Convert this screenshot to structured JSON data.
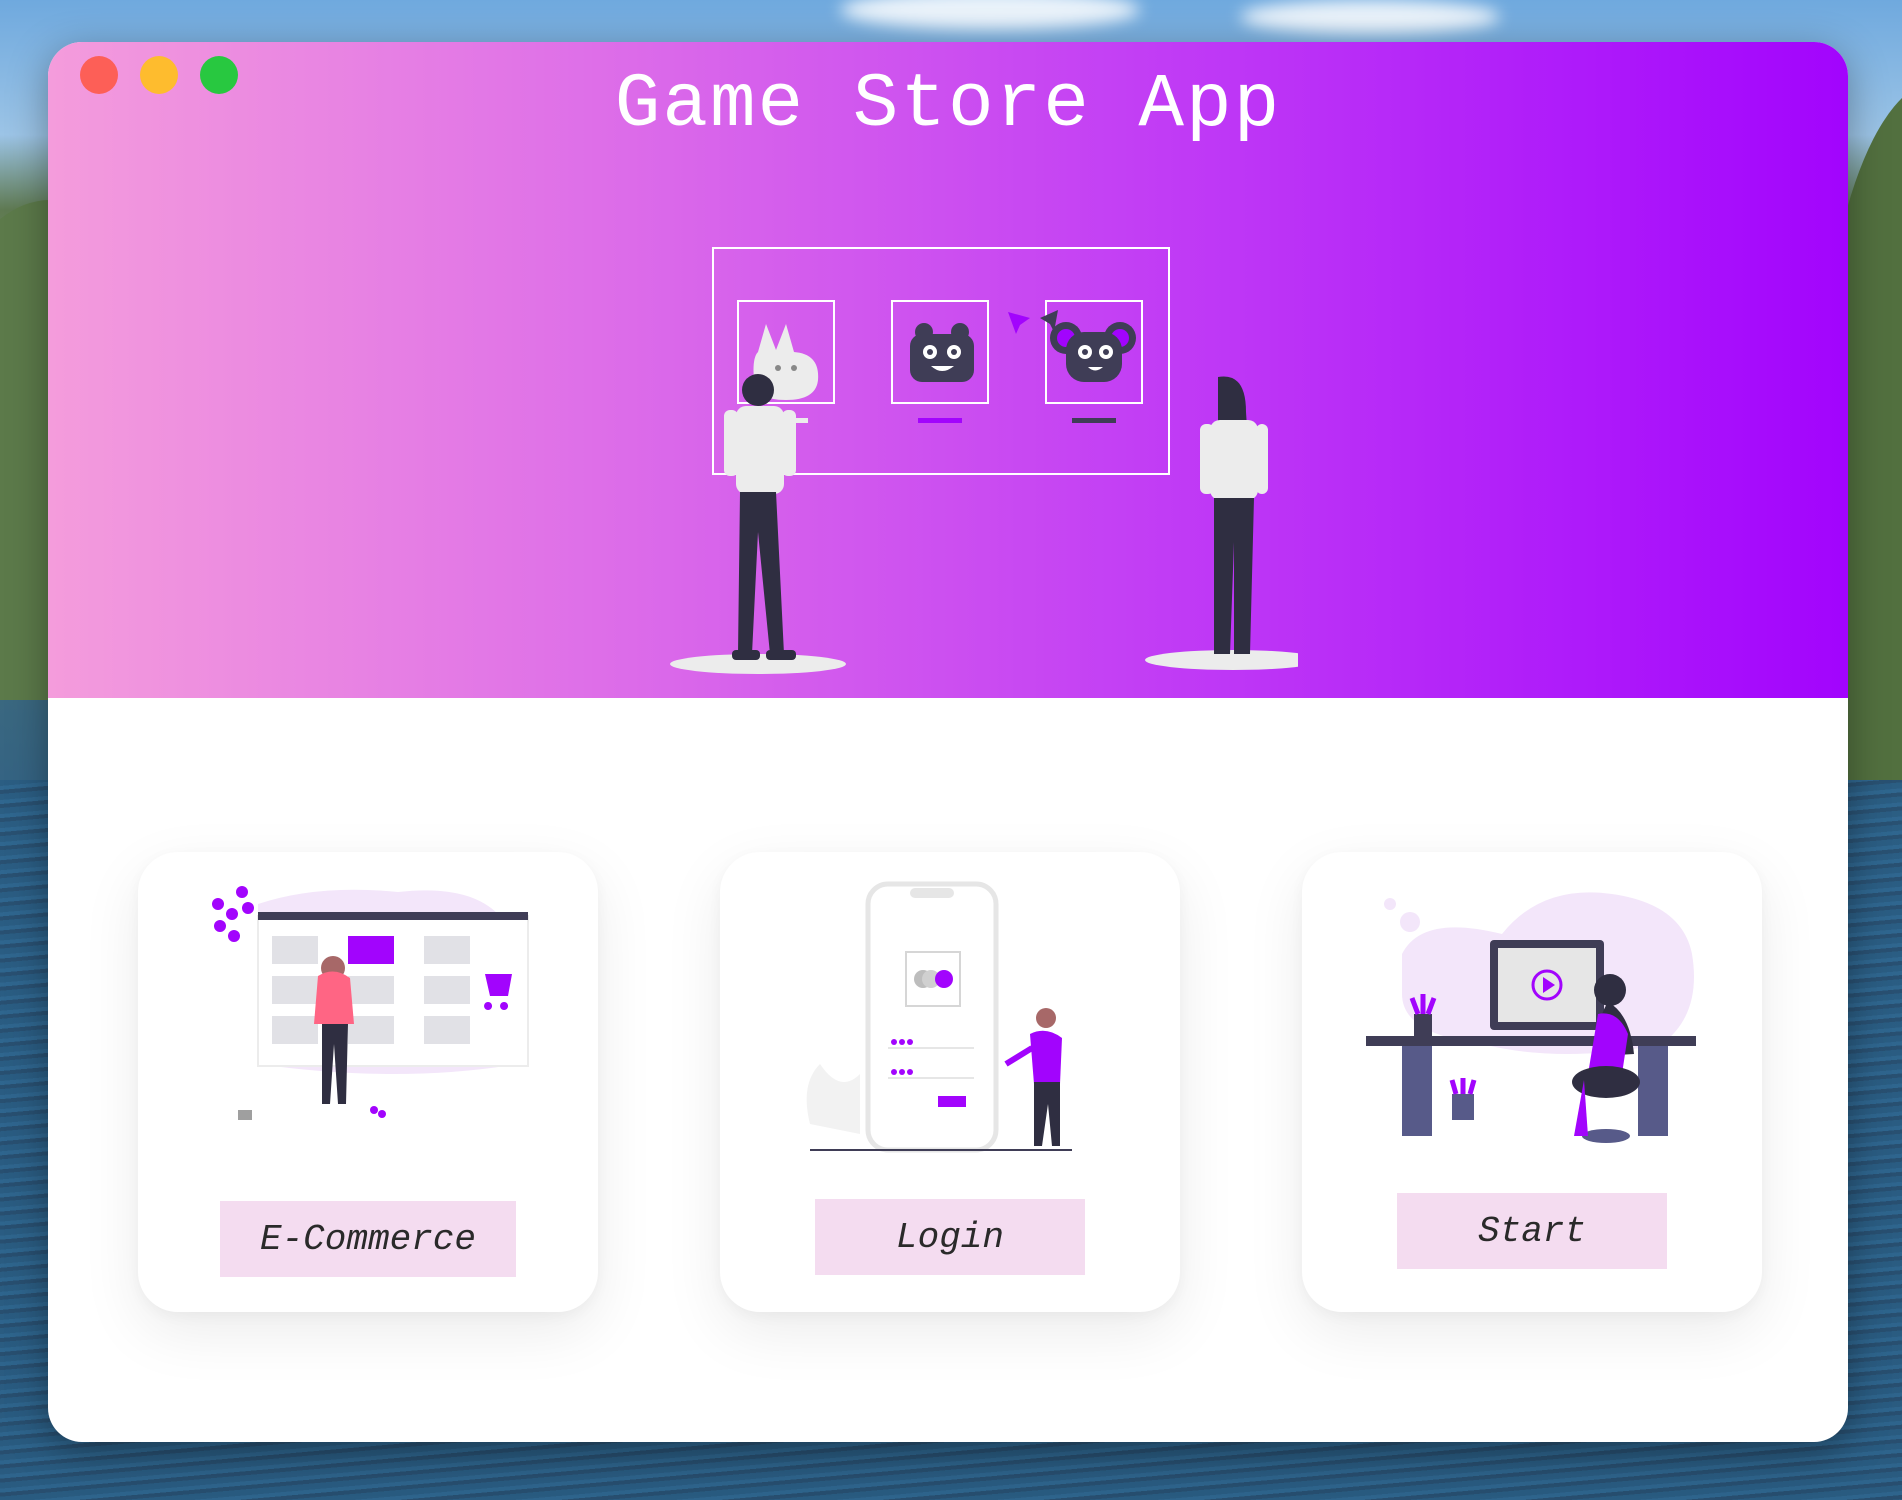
{
  "window": {
    "title": "Game Store App",
    "controls": [
      "close",
      "minimize",
      "maximize"
    ]
  },
  "hero": {
    "illustration": "people-browsing-game-store-icon",
    "gradient_start": "#f49cdc",
    "gradient_end": "#a204fd"
  },
  "cards": [
    {
      "label": "E-Commerce",
      "illustration": "online-shopping-icon"
    },
    {
      "label": "Login",
      "illustration": "mobile-login-icon"
    },
    {
      "label": "Start",
      "illustration": "video-desk-icon"
    }
  ],
  "colors": {
    "accent": "#a204fd",
    "button_bg": "#f4dcf0",
    "card_bg": "#ffffff"
  }
}
